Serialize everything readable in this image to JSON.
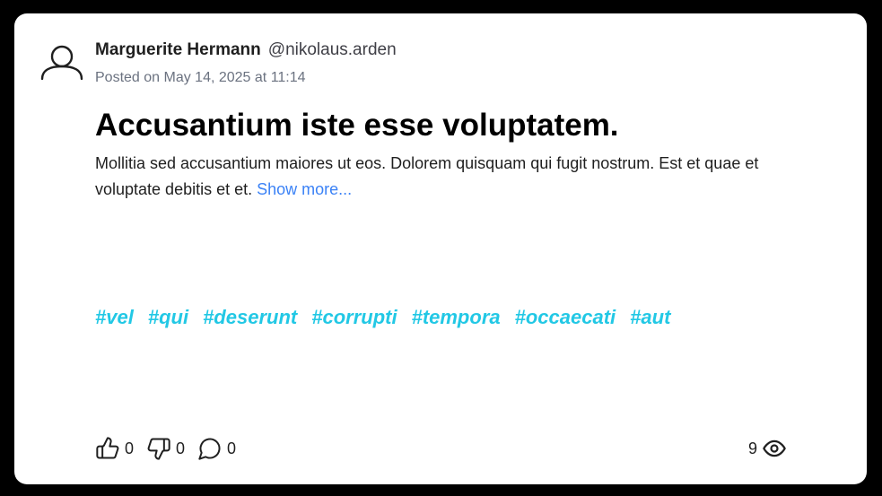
{
  "post": {
    "author_name": "Marguerite Hermann",
    "author_handle": "@nikolaus.arden",
    "posted_at": "Posted on May 14, 2025 at 11:14",
    "title": "Accusantium iste esse voluptatem.",
    "body": "Mollitia sed accusantium maiores ut eos. Dolorem quisquam qui fugit nostrum. Est et quae et voluptate debitis et et.",
    "show_more_label": "Show more...",
    "tags": [
      "#vel",
      "#qui",
      "#deserunt",
      "#corrupti",
      "#tempora",
      "#occaecati",
      "#aut"
    ]
  },
  "actions": {
    "likes": "0",
    "dislikes": "0",
    "comments": "0",
    "views": "9"
  },
  "icons": {
    "avatar": "user-icon",
    "like": "thumbs-up-icon",
    "dislike": "thumbs-down-icon",
    "comment": "comment-bubble-icon",
    "views": "eye-icon"
  },
  "colors": {
    "background": "#000000",
    "card": "#ffffff",
    "link": "#3b82f6",
    "tag": "#22c8e5",
    "muted": "#6b7280"
  }
}
